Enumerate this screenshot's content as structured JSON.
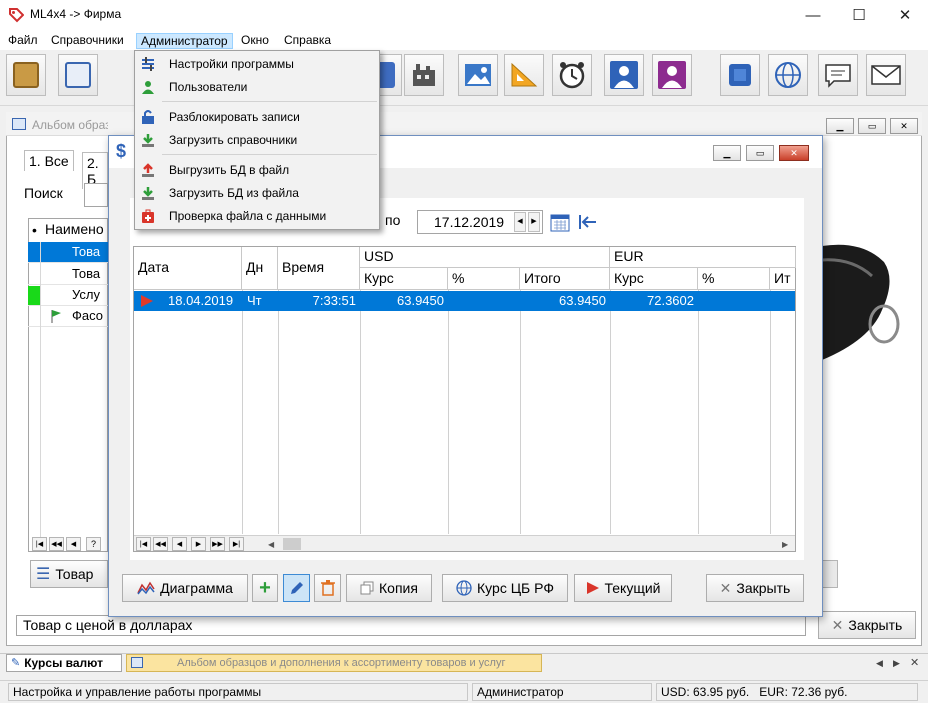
{
  "app": {
    "title": "ML4x4 -> Фирма",
    "window_controls": {
      "minimize": "—",
      "maximize": "☐",
      "close": "✕"
    }
  },
  "menubar": {
    "items": [
      "Файл",
      "Справочники",
      "Администратор",
      "Окно",
      "Справка"
    ]
  },
  "admin_menu": {
    "items": [
      {
        "label": "Настройки программы",
        "icon": "settings-icon"
      },
      {
        "label": "Пользователи",
        "icon": "users-icon"
      },
      {
        "label": "Разблокировать записи",
        "icon": "unlock-icon"
      },
      {
        "label": "Загрузить справочники",
        "icon": "download-icon"
      },
      {
        "label": "Выгрузить БД в файл",
        "icon": "upload-icon"
      },
      {
        "label": "Загрузить БД из файла",
        "icon": "download-icon"
      },
      {
        "label": "Проверка файла с данными",
        "icon": "medkit-icon"
      }
    ]
  },
  "toolbar": {
    "icons": [
      "box-icon",
      "catalog-icon",
      "factory-icon",
      "warehouse-icon",
      "picture-icon",
      "ruler-icon",
      "clock-icon",
      "man-icon",
      "woman-icon",
      "chip-icon",
      "globe-icon",
      "chat-icon",
      "mail-icon"
    ]
  },
  "background_window": {
    "title": "Альбом образцов и дополнения к ассортименту товаров и услуг",
    "tabs": [
      "1. Все",
      "2. Б"
    ],
    "search_label": "Поиск",
    "table_header": "Наимено",
    "rows": [
      "Това",
      "Това",
      "Услу",
      "Фасо"
    ],
    "bottom_button": "Товар",
    "description": "Товар с ценой в долларах",
    "close_button": "Закрыть",
    "nav_help": "?"
  },
  "rates_window": {
    "title_icon": "$",
    "date_to_label": "по",
    "date_to_value": "17.12.2019",
    "grid": {
      "headers": {
        "date": "Дата",
        "day": "Дн",
        "time": "Время",
        "usd": "USD",
        "eur": "EUR",
        "rate": "Курс",
        "pct": "%",
        "total": "Итого",
        "total_cut": "Ит"
      },
      "rows": [
        {
          "date": "18.04.2019",
          "day": "Чт",
          "time": "7:33:51",
          "usd_rate": "63.9450",
          "usd_pct": "",
          "usd_total": "63.9450",
          "eur_rate": "72.3602",
          "eur_pct": ""
        }
      ]
    },
    "buttons": {
      "chart": "Диаграмма",
      "copy": "Копия",
      "cbr_rate": "Курс ЦБ РФ",
      "current": "Текущий",
      "close": "Закрыть"
    }
  },
  "bottom_tabs": {
    "active": "Курсы валют",
    "second": "Альбом образцов и дополнения к ассортименту товаров и услуг"
  },
  "statusbar": {
    "hint": "Настройка и управление работы программы",
    "user": "Администратор",
    "rates": "USD: 63.95 руб.   EUR: 72.36 руб."
  },
  "colors": {
    "selection": "#0078d7",
    "accent_green": "#2e9e3a",
    "accent_red": "#d9352a",
    "menu_hover": "#cce8ff"
  }
}
